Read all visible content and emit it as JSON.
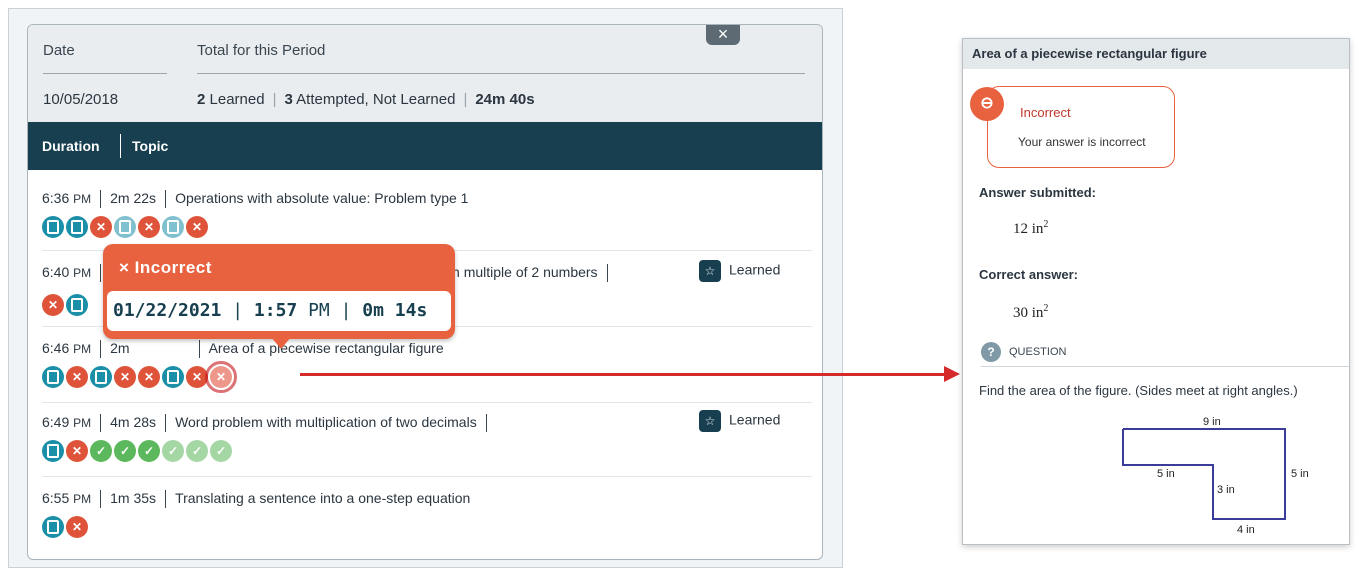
{
  "summary": {
    "date_label": "Date",
    "total_label": "Total for this Period",
    "date_value": "10/05/2018",
    "learned_count": "2",
    "learned_text": "Learned",
    "attempted_count": "3",
    "attempted_text": "Attempted, Not Learned",
    "duration_value": "24m 40s",
    "close_icon": "×"
  },
  "table_header": {
    "duration": "Duration",
    "topic": "Topic"
  },
  "rows": [
    {
      "time": "6:36",
      "ampm": "PM",
      "duration": "2m 22s",
      "topic": "Operations with absolute value: Problem type 1",
      "learned": ""
    },
    {
      "time": "6:40",
      "ampm": "PM",
      "duration": "",
      "topic": "common multiple of 2 numbers",
      "learned": "Learned"
    },
    {
      "time": "6:46",
      "ampm": "PM",
      "duration": "2m",
      "topic": "Area of a piecewise rectangular figure",
      "learned": ""
    },
    {
      "time": "6:49",
      "ampm": "PM",
      "duration": "4m 28s",
      "topic": "Word problem with multiplication of two decimals",
      "learned": "Learned"
    },
    {
      "time": "6:55",
      "ampm": "PM",
      "duration": "1m 35s",
      "topic": "Translating a sentence into a one-step equation",
      "learned": ""
    }
  ],
  "tooltip": {
    "title": "× Incorrect",
    "date": "01/22/2021",
    "time": "1:57",
    "ampm": "PM",
    "duration": "0m 14s"
  },
  "right_panel": {
    "title": "Area of a piecewise rectangular figure",
    "feedback_title": "Incorrect",
    "feedback_text": "Your answer is incorrect",
    "answer_submitted_label": "Answer submitted:",
    "answer_submitted_value": "12 in",
    "answer_submitted_exp": "2",
    "correct_answer_label": "Correct answer:",
    "correct_answer_value": "30 in",
    "correct_answer_exp": "2",
    "question_label": "QUESTION",
    "question_text": "Find the area of the figure. (Sides meet at right angles.)",
    "fig_top": "9 in",
    "fig_left": "5 in",
    "fig_right": "5 in",
    "fig_inner": "3 in",
    "fig_bottom": "4 in"
  },
  "colors": {
    "header_dark": "#173f4f",
    "incorrect": "#e8623f",
    "correct": "#5cb85c",
    "doc": "#1b8fa8",
    "arrow": "#d42a2a"
  }
}
